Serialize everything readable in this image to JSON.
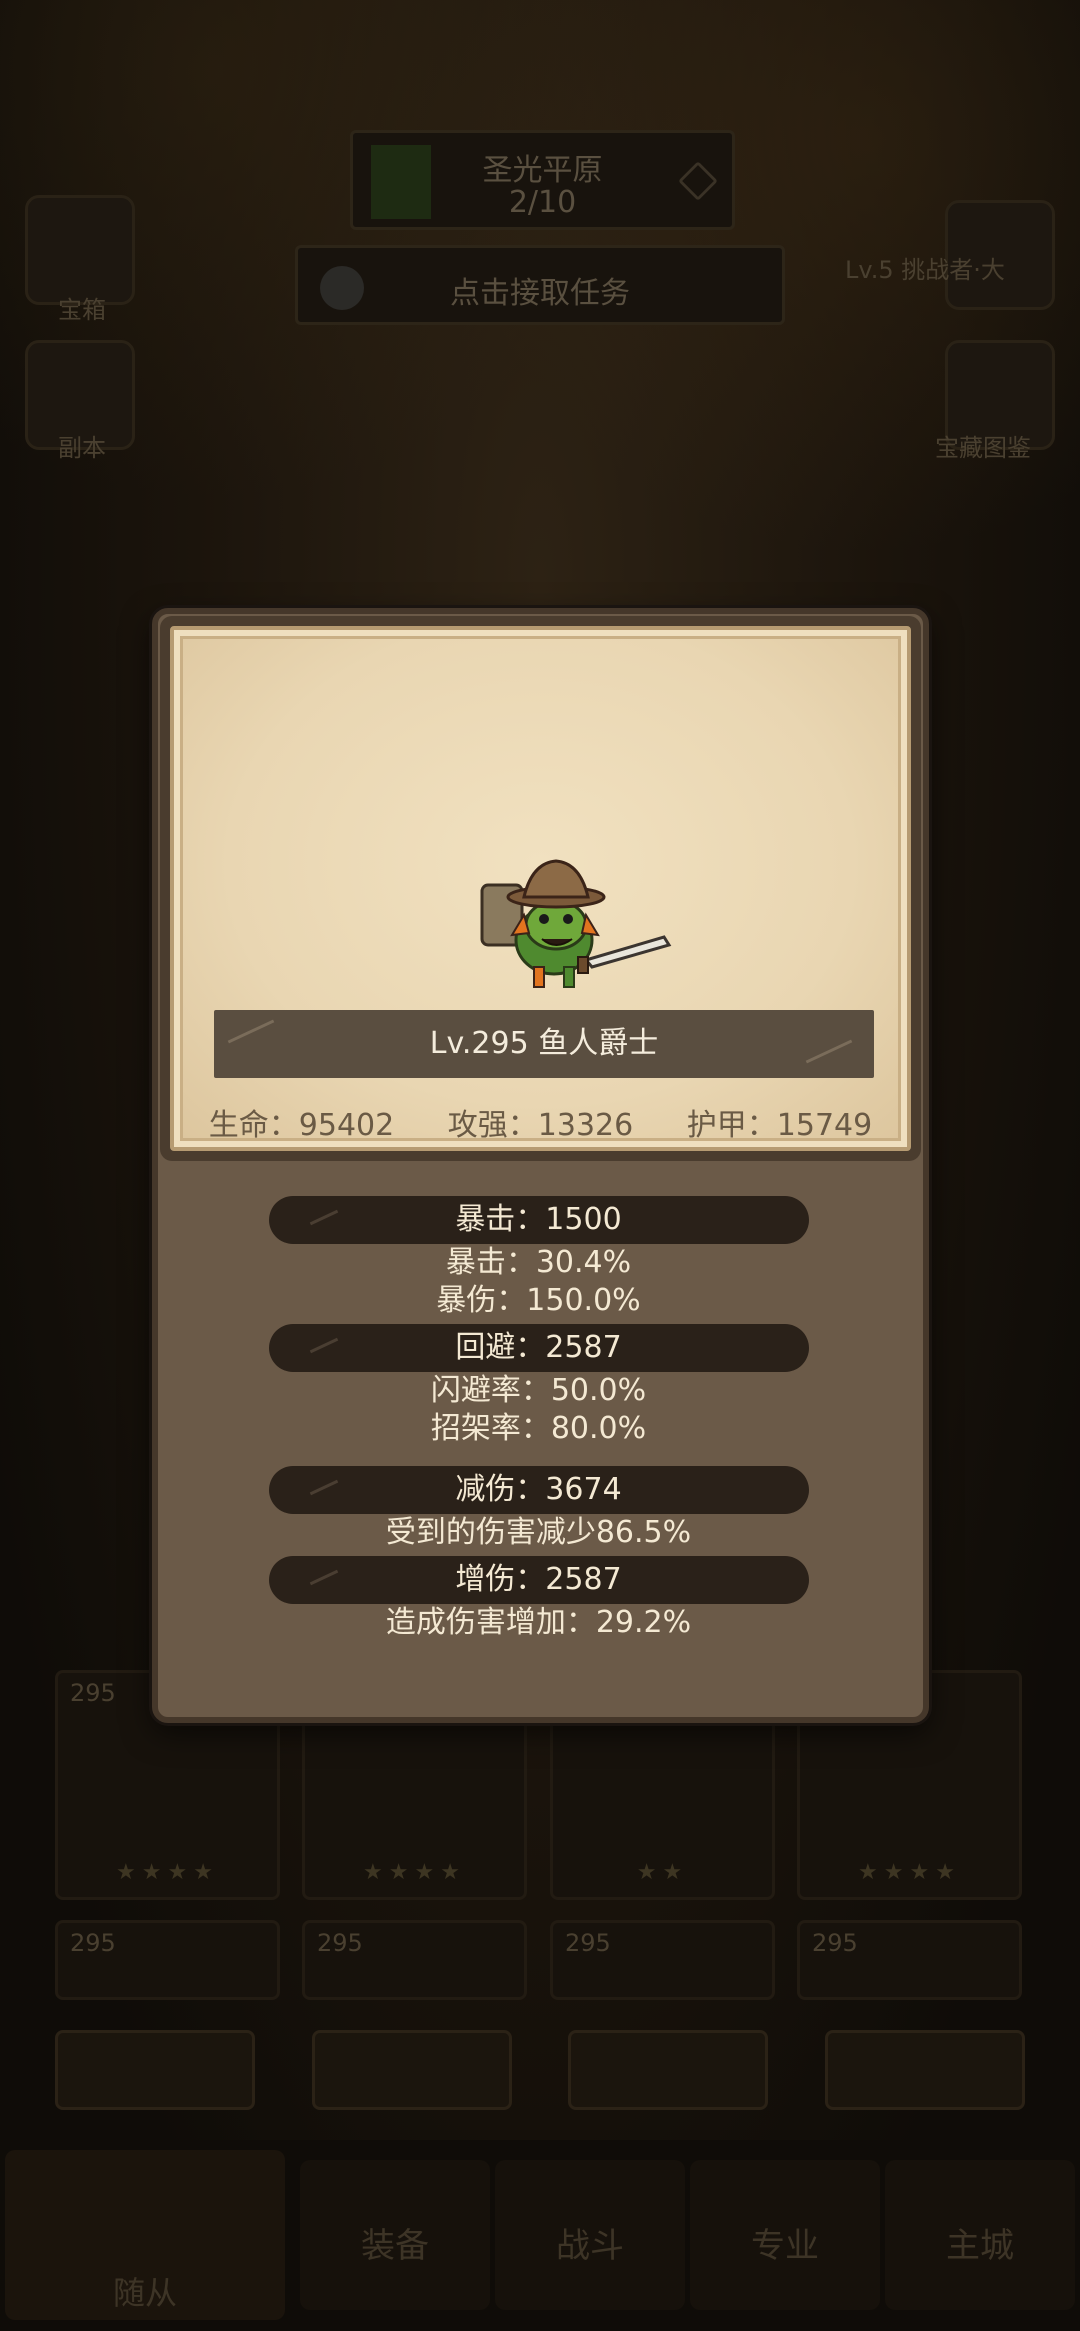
{
  "background": {
    "stage": {
      "name": "圣光平原",
      "progress": "2/10"
    },
    "quest": {
      "label": "点击接取任务"
    },
    "left_icons": [
      "宝箱",
      "副本"
    ],
    "right_icons": [
      "Lv.5 挑战者·大",
      "宝藏图鉴"
    ],
    "card_level": "295",
    "bottom_buttons": [
      "",
      "",
      "",
      ""
    ],
    "nav_tabs": [
      "随从",
      "装备",
      "战斗",
      "专业",
      "主城"
    ]
  },
  "modal": {
    "hero": {
      "level_name": "Lv.295 鱼人爵士",
      "hp_label": "生命：95402",
      "atk_label": "攻强：13326",
      "armor_label": "护甲：15749"
    },
    "stats": [
      {
        "header": "暴击：1500",
        "lines": [
          "暴击：30.4%",
          "暴伤：150.0%"
        ]
      },
      {
        "header": "回避：2587",
        "lines": [
          "闪避率：50.0%",
          "招架率：80.0%"
        ]
      },
      {
        "header": "减伤：3674",
        "lines": [
          "受到的伤害减少86.5%"
        ]
      },
      {
        "header": "增伤：2587",
        "lines": [
          "造成伤害增加：29.2%"
        ]
      }
    ]
  }
}
